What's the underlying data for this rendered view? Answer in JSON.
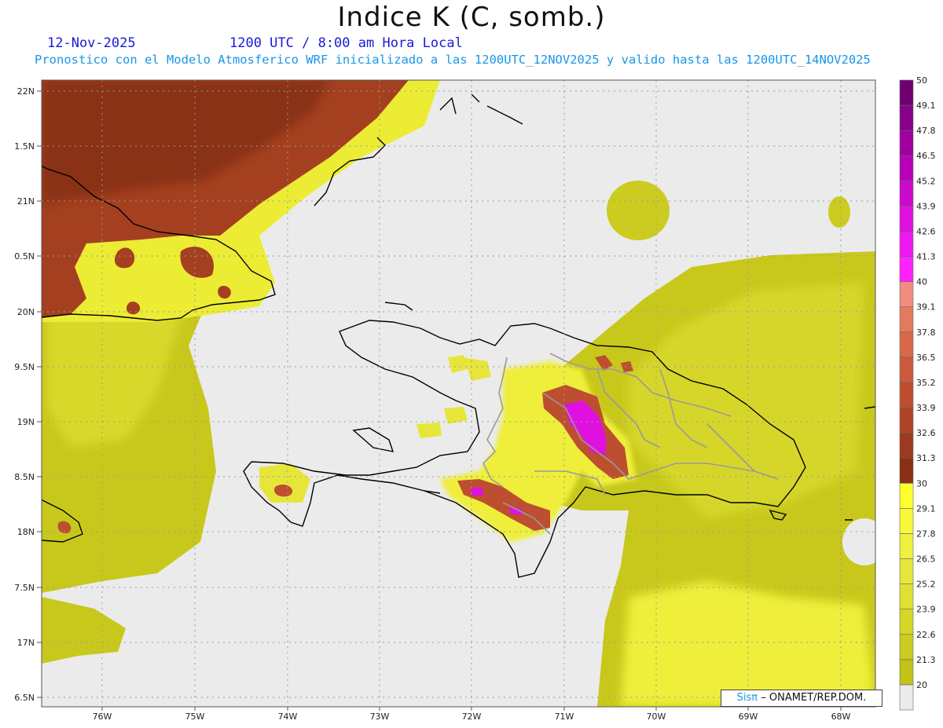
{
  "header": {
    "title": "Indice K (C, somb.)",
    "date": "12-Nov-2025",
    "time": "1200 UTC / 8:00 am Hora Local",
    "subtitle": "Pronostico con el Modelo Atmosferico WRF inicializado a las 1200UTC_12NOV2025 y valido hasta las  1200UTC_14NOV2025"
  },
  "map": {
    "lat_labels": [
      "22N",
      "1.5N",
      "21N",
      "0.5N",
      "20N",
      "9.5N",
      "19N",
      "8.5N",
      "18N",
      "7.5N",
      "17N",
      "6.5N"
    ],
    "lon_labels": [
      "76W",
      "75W",
      "74W",
      "73W",
      "72W",
      "71W",
      "70W",
      "69W",
      "68W"
    ],
    "lat_range": [
      16.5,
      22.0
    ],
    "lon_range": [
      -76.6,
      -67.6
    ],
    "grid": true
  },
  "colorbar": {
    "levels": [
      "20",
      "21.3",
      "22.6",
      "23.9",
      "25.2",
      "26.5",
      "27.8",
      "29.1",
      "30",
      "31.3",
      "32.6",
      "33.9",
      "35.2",
      "36.5",
      "37.8",
      "39.1",
      "40",
      "41.3",
      "42.6",
      "43.9",
      "45.2",
      "46.5",
      "47.8",
      "49.1",
      "50"
    ],
    "colors": [
      "#c2c218",
      "#cccc20",
      "#d6d628",
      "#e0e032",
      "#e6e63a",
      "#f0f040",
      "#f8f838",
      "#ffff2e",
      "#8a3015",
      "#9c3a1e",
      "#ae4426",
      "#be4e30",
      "#cc5a3c",
      "#d8684a",
      "#e47a5c",
      "#f08c80",
      "#ff22ff",
      "#f018f0",
      "#e010e0",
      "#cc08cc",
      "#b800b8",
      "#a000a0",
      "#880088",
      "#700070"
    ],
    "below_color": "#ebebeb"
  },
  "credit": {
    "brand": "Sisπ",
    "text": " ONAMET/REP.DOM."
  }
}
